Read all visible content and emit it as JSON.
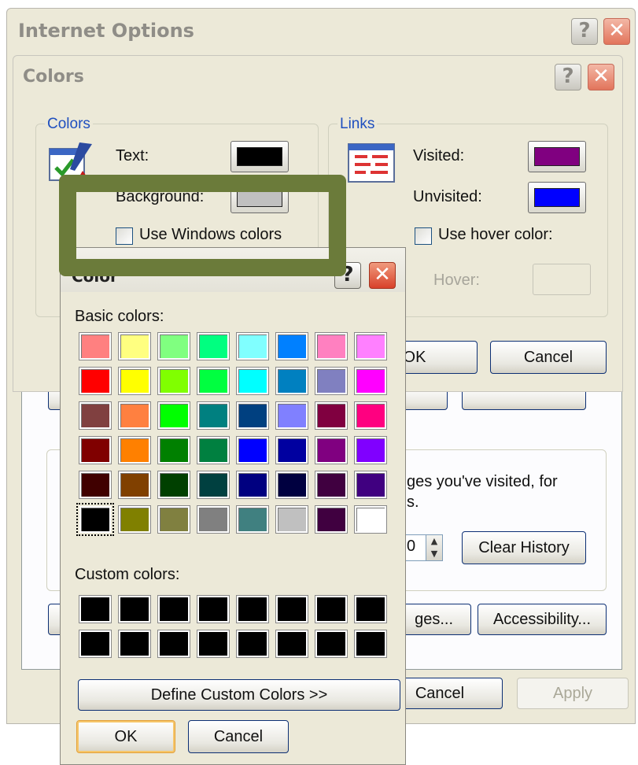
{
  "internet_options": {
    "title": "Internet Options",
    "history_text_line1": "ges you've visited, for",
    "history_text_line2": "s.",
    "days_value": "0",
    "clear_history_label": "Clear History",
    "languages_label": "ges...",
    "accessibility_label": "Accessibility...",
    "cancel_label": "Cancel",
    "apply_label": "Apply"
  },
  "colors_dialog": {
    "title": "Colors",
    "colors_group_label": "Colors",
    "links_group_label": "Links",
    "text_label": "Text:",
    "background_label": "Background:",
    "use_windows_colors_label": "Use Windows colors",
    "visited_label": "Visited:",
    "unvisited_label": "Unvisited:",
    "use_hover_label": "Use hover color:",
    "hover_label": "Hover:",
    "ok_label": "OK",
    "cancel_label": "Cancel",
    "colors": {
      "text": "#000000",
      "background": "#c0c0c0",
      "visited": "#800080",
      "unvisited": "#0000ff",
      "hover": "#ece9d8"
    }
  },
  "color_picker": {
    "title": "Color",
    "basic_colors_label": "Basic colors:",
    "custom_colors_label": "Custom colors:",
    "define_custom_label": "Define Custom Colors >>",
    "ok_label": "OK",
    "cancel_label": "Cancel",
    "basic_colors": [
      "#ff8080",
      "#ffff80",
      "#80ff80",
      "#00ff80",
      "#80ffff",
      "#0080ff",
      "#ff80c0",
      "#ff80ff",
      "#ff0000",
      "#ffff00",
      "#80ff00",
      "#00ff40",
      "#00ffff",
      "#0080c0",
      "#8080c0",
      "#ff00ff",
      "#804040",
      "#ff8040",
      "#00ff00",
      "#008080",
      "#004080",
      "#8080ff",
      "#800040",
      "#ff0080",
      "#800000",
      "#ff8000",
      "#008000",
      "#008040",
      "#0000ff",
      "#0000a0",
      "#800080",
      "#8000ff",
      "#400000",
      "#804000",
      "#004000",
      "#004040",
      "#000080",
      "#000040",
      "#400040",
      "#400080",
      "#000000",
      "#808000",
      "#808040",
      "#808080",
      "#408080",
      "#c0c0c0",
      "#400040",
      "#ffffff"
    ],
    "selected_index": 40,
    "custom_colors": [
      "#000000",
      "#000000",
      "#000000",
      "#000000",
      "#000000",
      "#000000",
      "#000000",
      "#000000",
      "#000000",
      "#000000",
      "#000000",
      "#000000",
      "#000000",
      "#000000",
      "#000000",
      "#000000"
    ]
  },
  "annotation": {
    "highlight_color": "#6b7b3a"
  }
}
